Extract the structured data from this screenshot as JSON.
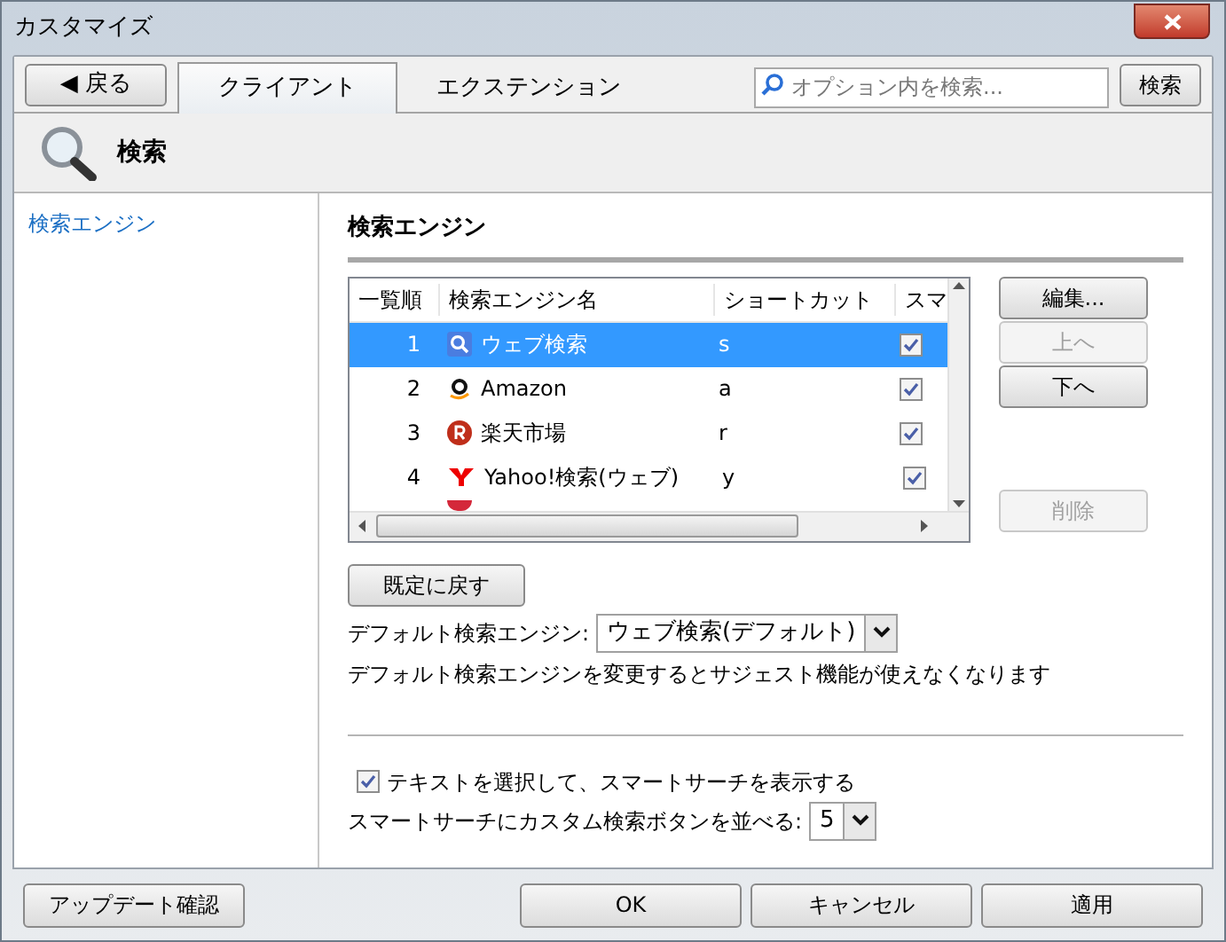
{
  "window": {
    "title": "カスタマイズ"
  },
  "back_button": "◀ 戻る",
  "tabs": [
    {
      "label": "クライアント",
      "selected": true
    },
    {
      "label": "エクステンション",
      "selected": false
    }
  ],
  "search": {
    "placeholder": "オプション内を検索...",
    "button": "検索"
  },
  "header": {
    "title": "検索"
  },
  "sidebar": {
    "items": [
      {
        "label": "検索エンジン",
        "selected": true
      }
    ]
  },
  "section_title": "検索エンジン",
  "table": {
    "columns": [
      "一覧順",
      "検索エンジン名",
      "ショートカット",
      "スマ"
    ],
    "rows": [
      {
        "order": "1",
        "name": "ウェブ検索",
        "shortcut": "s",
        "checked": true,
        "selected": true
      },
      {
        "order": "2",
        "name": "Amazon",
        "shortcut": "a",
        "checked": true,
        "selected": false
      },
      {
        "order": "3",
        "name": "楽天市場",
        "shortcut": "r",
        "checked": true,
        "selected": false
      },
      {
        "order": "4",
        "name": "Yahoo!検索(ウェブ)",
        "shortcut": "y",
        "checked": true,
        "selected": false
      }
    ]
  },
  "side_buttons": [
    {
      "label": "編集...",
      "disabled": false
    },
    {
      "label": "上へ",
      "disabled": true
    },
    {
      "label": "下へ",
      "disabled": false
    },
    {
      "label": "削除",
      "disabled": true
    }
  ],
  "reset_button": "既定に戻す",
  "default_engine": {
    "label": "デフォルト検索エンジン:",
    "value": "ウェブ検索(デフォルト)"
  },
  "note": "デフォルト検索エンジンを変更するとサジェスト機能が使えなくなります",
  "smart_search": {
    "label": "テキストを選択して、スマートサーチを表示する",
    "checked": true
  },
  "button_count": {
    "label": "スマートサーチにカスタム検索ボタンを並べる:",
    "value": "5"
  },
  "footer_buttons": [
    {
      "label": "アップデート確認"
    },
    {
      "label": "OK"
    },
    {
      "label": "キャンセル"
    },
    {
      "label": "適用"
    }
  ]
}
